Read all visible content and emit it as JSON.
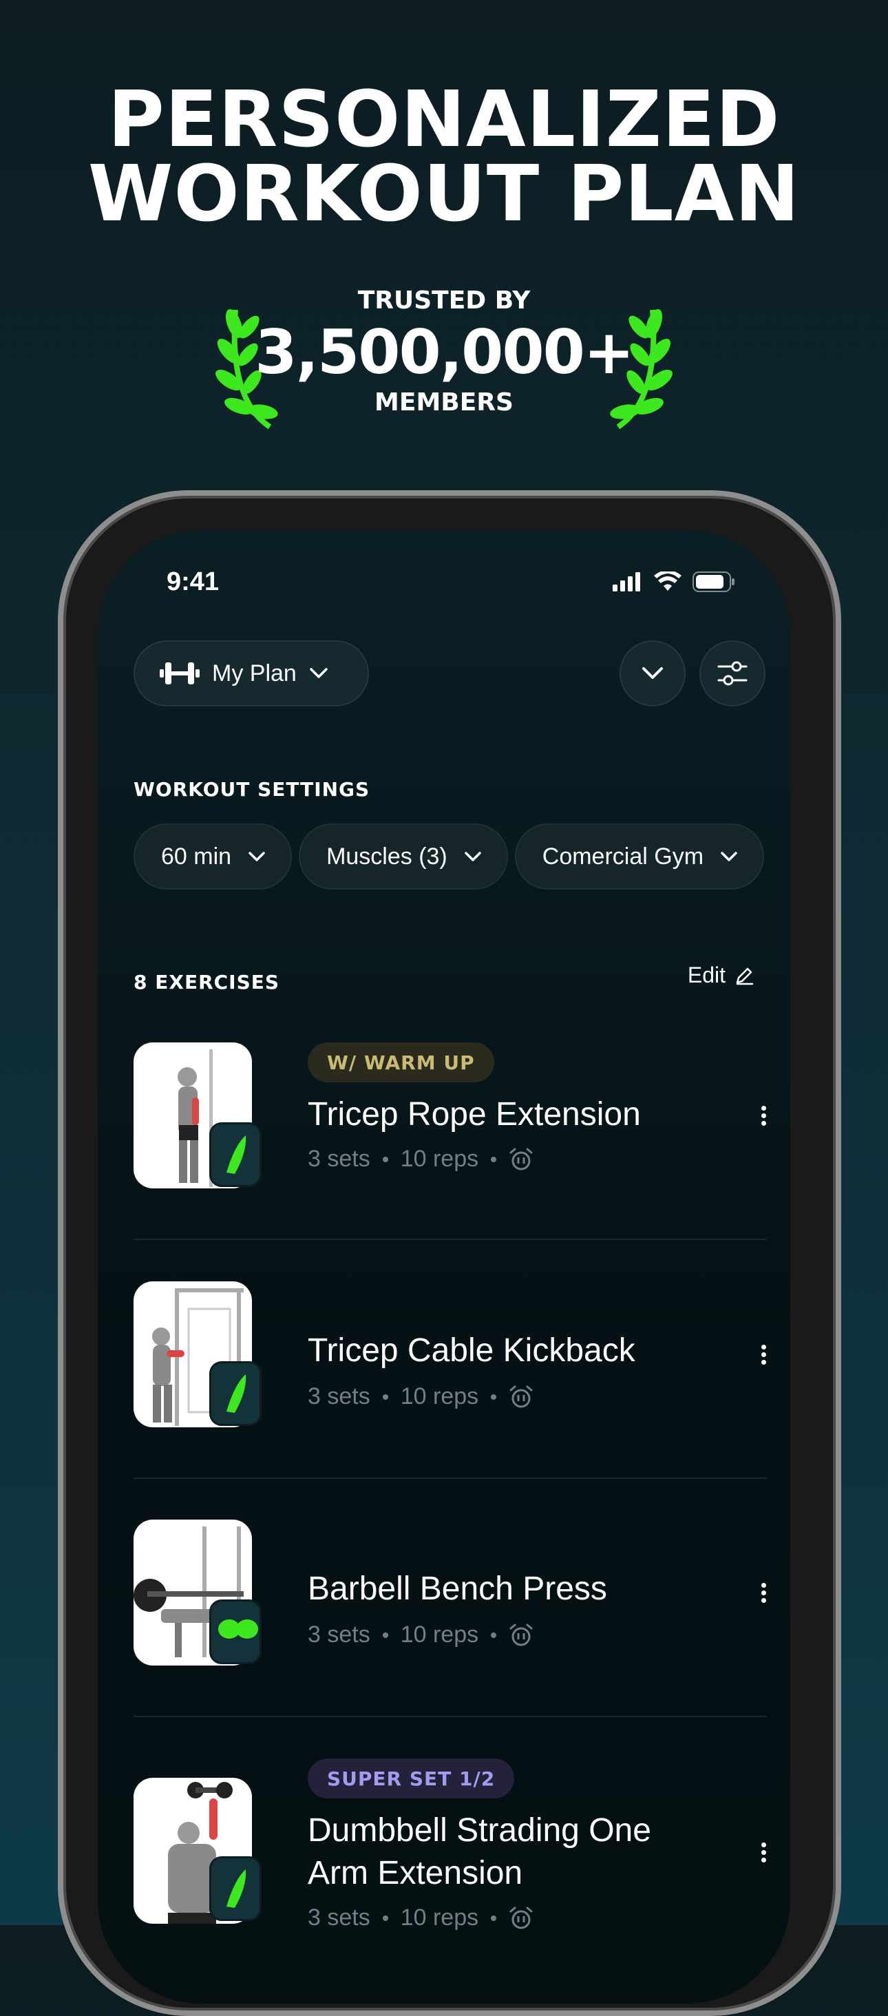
{
  "promo": {
    "headline_line1": "PERSONALIZED",
    "headline_line2": "WORKOUT PLAN",
    "trusted_by": "TRUSTED BY",
    "members_count": "3,500,000+",
    "members": "MEMBERS"
  },
  "status_bar": {
    "time": "9:41"
  },
  "header": {
    "plan_label": "My Plan"
  },
  "workout_settings": {
    "title": "WORKOUT SETTINGS",
    "chips": [
      "60 min",
      "Muscles (3)",
      "Comercial Gym"
    ]
  },
  "exercises": {
    "title": "8 EXERCISES",
    "edit_label": "Edit",
    "items": [
      {
        "badge": "W/ WARM UP",
        "name": "Tricep Rope Extension",
        "sets": "3 sets",
        "reps": "10 reps"
      },
      {
        "name": "Tricep Cable Kickback",
        "sets": "3 sets",
        "reps": "10 reps"
      },
      {
        "name": "Barbell Bench Press",
        "sets": "3 sets",
        "reps": "10 reps"
      },
      {
        "badge": "SUPER SET 1/2",
        "name_line1": "Dumbbell Strading One",
        "name_line2": "Arm Extension",
        "sets": "3 sets",
        "reps": "10 reps"
      }
    ]
  },
  "colors": {
    "accent_green": "#3ee81f",
    "warm_up_badge_text": "#c9bb72",
    "super_set_badge_text": "#a49bf0"
  }
}
